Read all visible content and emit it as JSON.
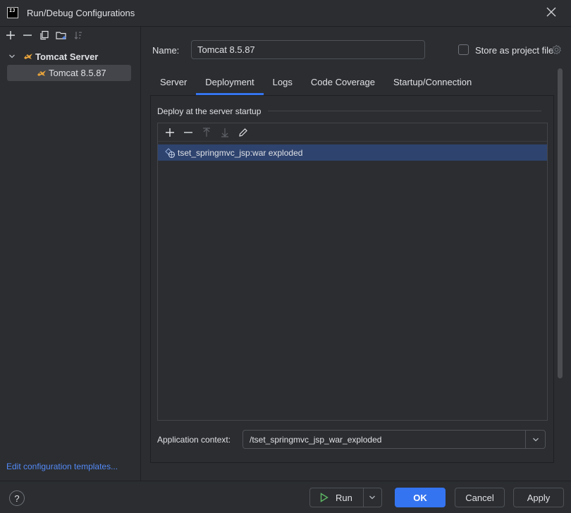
{
  "window": {
    "title": "Run/Debug Configurations",
    "app_icon_text": "IJ"
  },
  "tree": {
    "group_label": "Tomcat Server",
    "child_label": "Tomcat 8.5.87"
  },
  "left_footer": {
    "templates_link": "Edit configuration templates..."
  },
  "form": {
    "name_label": "Name:",
    "name_value": "Tomcat 8.5.87",
    "store_label": "Store as project file",
    "store_checked": false
  },
  "tabs": [
    {
      "label": "Server"
    },
    {
      "label": "Deployment",
      "active": true
    },
    {
      "label": "Logs"
    },
    {
      "label": "Code Coverage"
    },
    {
      "label": "Startup/Connection"
    }
  ],
  "deployment": {
    "section_title": "Deploy at the server startup",
    "items": [
      "tset_springmvc_jsp:war exploded"
    ],
    "context_label": "Application context:",
    "context_value": "/tset_springmvc_jsp_war_exploded"
  },
  "footer": {
    "help_label": "?",
    "run_label": "Run",
    "ok_label": "OK",
    "cancel_label": "Cancel",
    "apply_label": "Apply"
  },
  "colors": {
    "accent": "#3574f0",
    "selection": "#2e436e",
    "run_icon": "#5fb865",
    "link": "#548af7"
  },
  "icons": {
    "add": "plus-icon",
    "remove": "minus-icon",
    "copy": "copy-icon",
    "folder": "new-folder-icon",
    "sort": "sort-icon",
    "server": "tomcat-icon",
    "artifact": "artifact-icon",
    "up": "arrow-up-icon",
    "down": "arrow-down-icon",
    "edit": "pencil-icon",
    "dropdown": "chevron-down-icon",
    "close": "close-icon",
    "gear": "gear-icon",
    "run": "play-icon"
  }
}
